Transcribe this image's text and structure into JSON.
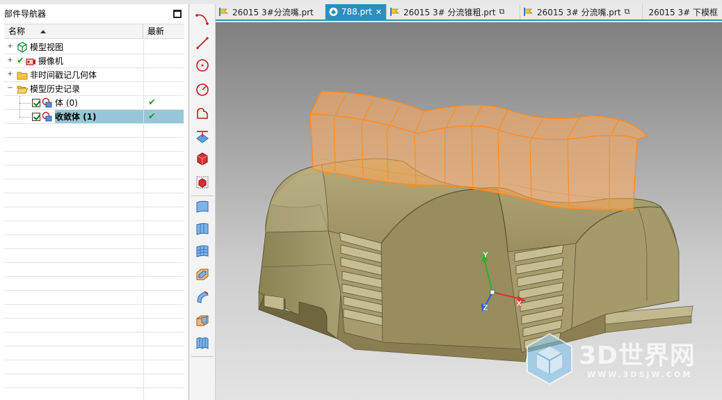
{
  "navigator": {
    "title": "部件导航器",
    "columns": {
      "name": "名称",
      "latest": "最新"
    },
    "tree": [
      {
        "label": "模型视图",
        "expander": "+",
        "icon": "model-views-icon"
      },
      {
        "label": "摄像机",
        "expander": "+",
        "icon": "camera-icon"
      },
      {
        "label": "非时间戳记几何体",
        "expander": "+",
        "icon": "folder-icon"
      },
      {
        "label": "模型历史记录",
        "expander": "−",
        "icon": "folder-open-icon"
      },
      {
        "label": "体 (0)",
        "icon": "body-feature-icon",
        "checked": true,
        "latest": "✔"
      },
      {
        "label": "收敛体 (1)",
        "icon": "convergent-body-icon",
        "checked": true,
        "latest": "✔",
        "selected": true
      }
    ]
  },
  "tabs": [
    {
      "label": "26015 3#分流嘴.prt",
      "active": false,
      "modified": false,
      "icon": "part-file-icon"
    },
    {
      "label": "788.prt",
      "active": true,
      "close": "✕",
      "icon": "part-file-active-icon"
    },
    {
      "label": "26015 3# 分流锥粗.prt",
      "active": false,
      "modified": true,
      "icon": "part-file-icon"
    },
    {
      "label": "26015 3# 分流嘴.prt",
      "active": false,
      "modified": true,
      "icon": "part-file-icon"
    },
    {
      "label": "26015 3# 下模框",
      "active": false,
      "modified": false,
      "icon": "part-file-icon"
    }
  ],
  "vtoolbar": [
    "arc-curve-icon",
    "line-icon",
    "circle-icon",
    "arc-center-icon",
    "studio-spline-icon",
    "extract-curve-icon",
    "block-solid-icon",
    "block-outline-icon",
    "surface-patch-icon",
    "through-curves-icon",
    "mesh-surface-icon",
    "offset-face-icon",
    "sweep-icon",
    "box-trim-icon",
    "ruled-surface-icon"
  ],
  "axes": {
    "x": "X",
    "y": "Y",
    "z": "Z"
  },
  "watermark": {
    "main": "3D世界网",
    "sub": "WWW.3DSJW.COM"
  },
  "colors": {
    "accent": "#2d8fbf",
    "selection": "#96c7d6",
    "highlight": "#ff9a3c",
    "model": "#a39a6c"
  }
}
